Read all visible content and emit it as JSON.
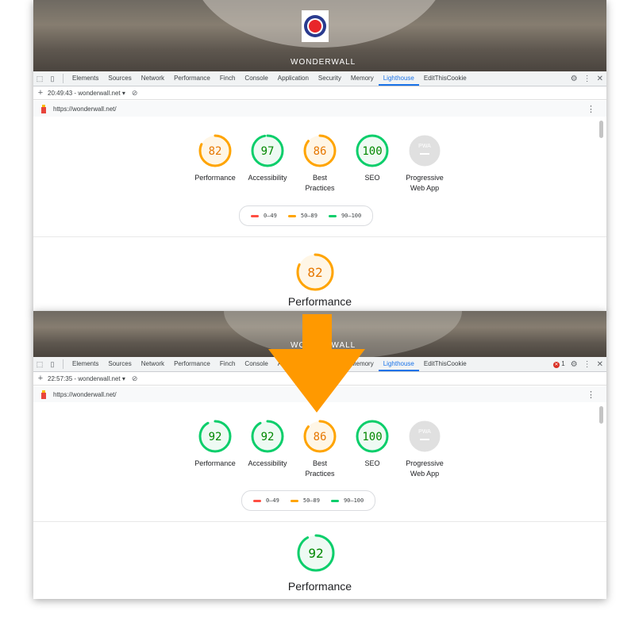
{
  "colors": {
    "orange": "#ffa400",
    "green": "#0cce6b",
    "red": "#ff4e42",
    "gray": "#cccccc",
    "active_tab": "#1a73e8",
    "arrow": "#ff9900"
  },
  "website": {
    "name": "WONDERWALL"
  },
  "devtools": {
    "tabs": [
      "Elements",
      "Sources",
      "Network",
      "Performance",
      "Finch",
      "Console",
      "Application",
      "Security",
      "Memory",
      "Lighthouse",
      "EditThisCookie"
    ],
    "active_tab": "Lighthouse",
    "icons": [
      "inspect-icon",
      "device-toggle-icon",
      "settings-icon",
      "more-options-icon",
      "close-icon"
    ]
  },
  "report_before": {
    "run_label": "20:49:43 - wonderwall.net ▾",
    "url": "https://wonderwall.net/",
    "categories": [
      {
        "label": "Performance",
        "score": "82",
        "status": "orange"
      },
      {
        "label": "Accessibility",
        "score": "97",
        "status": "green"
      },
      {
        "label": "Best Practices",
        "score": "86",
        "status": "orange"
      },
      {
        "label": "SEO",
        "score": "100",
        "status": "green"
      },
      {
        "label": "Progressive Web App",
        "score": "PWA",
        "status": "gray"
      }
    ],
    "featured": {
      "label": "Performance",
      "score": "82",
      "status": "orange"
    }
  },
  "report_after": {
    "run_label": "22:57:35 - wonderwall.net ▾",
    "url": "https://wonderwall.net/",
    "error_count": "1",
    "categories": [
      {
        "label": "Performance",
        "score": "92",
        "status": "green"
      },
      {
        "label": "Accessibility",
        "score": "92",
        "status": "green"
      },
      {
        "label": "Best Practices",
        "score": "86",
        "status": "orange"
      },
      {
        "label": "SEO",
        "score": "100",
        "status": "green"
      },
      {
        "label": "Progressive Web App",
        "score": "PWA",
        "status": "gray"
      }
    ],
    "featured": {
      "label": "Performance",
      "score": "92",
      "status": "green"
    }
  },
  "legend": [
    {
      "range": "0–49",
      "status": "red"
    },
    {
      "range": "50–89",
      "status": "orange"
    },
    {
      "range": "90–100",
      "status": "green"
    }
  ]
}
